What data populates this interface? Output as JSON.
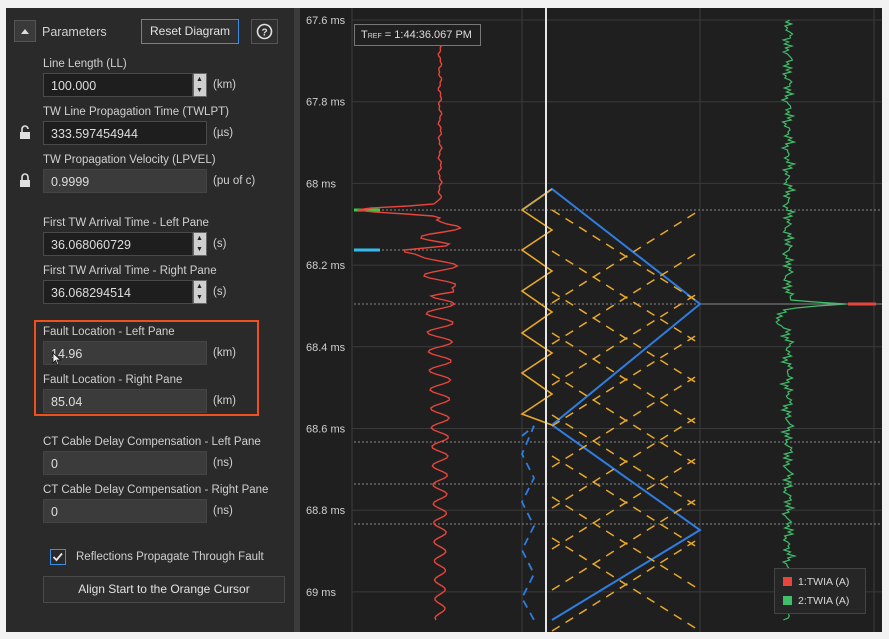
{
  "header": {
    "collapse_icon": "caret-up-icon",
    "title": "Parameters",
    "reset_label": "Reset Diagram",
    "help_icon": "question-circle-icon"
  },
  "fields": {
    "line_length": {
      "label": "Line Length (LL)",
      "value": "100.000",
      "unit": "(km)"
    },
    "twlpt": {
      "label": "TW Line Propagation Time (TWLPT)",
      "value": "333.597454944",
      "unit": "(µs)"
    },
    "lpvel": {
      "label": "TW Propagation Velocity (LPVEL)",
      "value": "0.9999",
      "unit": "(pu of c)"
    },
    "first_left": {
      "label": "First TW Arrival Time - Left Pane",
      "value": "36.068060729",
      "unit": "(s)"
    },
    "first_right": {
      "label": "First TW Arrival Time - Right Pane",
      "value": "36.068294514",
      "unit": "(s)"
    },
    "fault_left": {
      "label": "Fault Location - Left Pane",
      "value": "14.96",
      "unit": "(km)"
    },
    "fault_right": {
      "label": "Fault Location - Right Pane",
      "value": "85.04",
      "unit": "(km)"
    },
    "ct_left": {
      "label": "CT Cable Delay Compensation - Left Pane",
      "value": "0",
      "unit": "(ns)"
    },
    "ct_right": {
      "label": "CT Cable Delay Compensation - Right Pane",
      "value": "0",
      "unit": "(ns)"
    }
  },
  "reflections_checkbox": {
    "label": "Reflections Propagate Through Fault",
    "checked": true
  },
  "align_button": "Align Start to the Orange Cursor",
  "plot": {
    "tref": "1:44:36.067 PM",
    "tref_prefix": "T",
    "tref_sub": "REF",
    "y_ticks": [
      "67.6 ms",
      "67.8 ms",
      "68 ms",
      "68.2 ms",
      "68.4 ms",
      "68.6 ms",
      "68.8 ms",
      "69 ms"
    ],
    "legend": [
      {
        "label": "1:TWIA (A)",
        "color": "#e8453c"
      },
      {
        "label": "2:TWIA (A)",
        "color": "#3fbf6a"
      }
    ],
    "colors": {
      "left_trace": "#e8453c",
      "right_trace": "#3fbf6a",
      "direct_wave": "#2f7de0",
      "reflection_wave": "#e8a82a",
      "cursor": "#e6e6e6",
      "highlight_box": "#f0501e"
    }
  }
}
